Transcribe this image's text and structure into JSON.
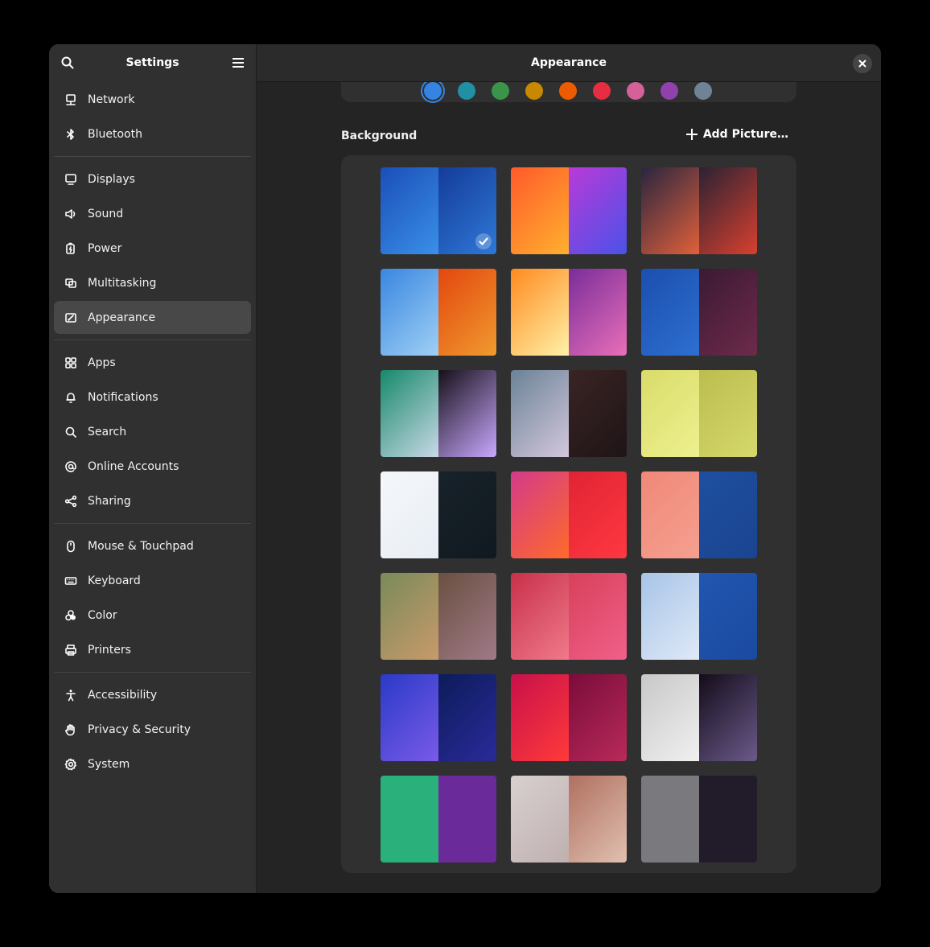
{
  "sidebar": {
    "title": "Settings",
    "search_icon": "search-icon",
    "menu_icon": "hamburger-menu-icon",
    "groups": [
      [
        {
          "label": "Network",
          "icon": "network-icon",
          "name": "network"
        },
        {
          "label": "Bluetooth",
          "icon": "bluetooth-icon",
          "name": "bluetooth"
        }
      ],
      [
        {
          "label": "Displays",
          "icon": "display-icon",
          "name": "displays"
        },
        {
          "label": "Sound",
          "icon": "speaker-icon",
          "name": "sound"
        },
        {
          "label": "Power",
          "icon": "battery-icon",
          "name": "power"
        },
        {
          "label": "Multitasking",
          "icon": "multitasking-icon",
          "name": "multitasking"
        },
        {
          "label": "Appearance",
          "icon": "appearance-icon",
          "name": "appearance",
          "active": true
        }
      ],
      [
        {
          "label": "Apps",
          "icon": "apps-grid-icon",
          "name": "apps"
        },
        {
          "label": "Notifications",
          "icon": "bell-icon",
          "name": "notifications"
        },
        {
          "label": "Search",
          "icon": "search-icon",
          "name": "search"
        },
        {
          "label": "Online Accounts",
          "icon": "at-sign-icon",
          "name": "online-accounts"
        },
        {
          "label": "Sharing",
          "icon": "share-icon",
          "name": "sharing"
        }
      ],
      [
        {
          "label": "Mouse & Touchpad",
          "icon": "mouse-icon",
          "name": "mouse-touchpad"
        },
        {
          "label": "Keyboard",
          "icon": "keyboard-icon",
          "name": "keyboard"
        },
        {
          "label": "Color",
          "icon": "color-icon",
          "name": "color"
        },
        {
          "label": "Printers",
          "icon": "printer-icon",
          "name": "printers"
        }
      ],
      [
        {
          "label": "Accessibility",
          "icon": "accessibility-icon",
          "name": "accessibility"
        },
        {
          "label": "Privacy & Security",
          "icon": "hand-icon",
          "name": "privacy-security"
        },
        {
          "label": "System",
          "icon": "gear-icon",
          "name": "system"
        }
      ]
    ]
  },
  "header": {
    "title": "Appearance",
    "close_icon": "close-icon"
  },
  "accent_colors": [
    {
      "hex": "#3584e4",
      "selected": true
    },
    {
      "hex": "#2190a4"
    },
    {
      "hex": "#3a944a"
    },
    {
      "hex": "#c88800"
    },
    {
      "hex": "#ed5b00"
    },
    {
      "hex": "#e62d42"
    },
    {
      "hex": "#d56199"
    },
    {
      "hex": "#9141ac"
    },
    {
      "hex": "#6f8396"
    }
  ],
  "background": {
    "label": "Background",
    "add_label": "Add Picture…",
    "add_icon": "plus-icon",
    "selected_icon": "checkmark-icon",
    "wallpapers": [
      {
        "left": [
          "#1a4fb8",
          "#3a8fe8"
        ],
        "right": [
          "#143c9a",
          "#2f78d6"
        ],
        "selected": true
      },
      {
        "left": [
          "#ff5a2a",
          "#ffb02e"
        ],
        "right": [
          "#b93ad8",
          "#4a52e8"
        ]
      },
      {
        "left": [
          "#2a2540",
          "#e0603a"
        ],
        "right": [
          "#2b2234",
          "#d8402e"
        ]
      },
      {
        "left": [
          "#3a86e0",
          "#9fd0f5"
        ],
        "right": [
          "#e3470f",
          "#f09a2e"
        ]
      },
      {
        "left": [
          "#ff8a1e",
          "#fff2a8"
        ],
        "right": [
          "#7a2d9a",
          "#e86fb8"
        ]
      },
      {
        "left": [
          "#1b4fae",
          "#2d6fd0"
        ],
        "right": [
          "#3a1a34",
          "#6e2a4a"
        ]
      },
      {
        "left": [
          "#16896a",
          "#c9d8e6"
        ],
        "right": [
          "#161019",
          "#c9a8ff"
        ]
      },
      {
        "left": [
          "#6b8296",
          "#d3c7dc"
        ],
        "right": [
          "#3a2424",
          "#1e1416"
        ]
      },
      {
        "left": [
          "#d9dc6a",
          "#eef08f"
        ],
        "right": [
          "#bcbd4f",
          "#d5d86c"
        ]
      },
      {
        "left": [
          "#f5f7fa",
          "#e8eef5"
        ],
        "right": [
          "#18222a",
          "#10191f"
        ]
      },
      {
        "left": [
          "#d33a8a",
          "#ff6a2a"
        ],
        "right": [
          "#e02434",
          "#ff3840"
        ]
      },
      {
        "left": [
          "#f08878",
          "#f5a090"
        ],
        "right": [
          "#1e4fa0",
          "#1a4490"
        ]
      },
      {
        "left": [
          "#7a8a5a",
          "#c89a6a"
        ],
        "right": [
          "#6a5040",
          "#a07a88"
        ]
      },
      {
        "left": [
          "#c8304a",
          "#f07a8a"
        ],
        "right": [
          "#d8405a",
          "#f0608a"
        ]
      },
      {
        "left": [
          "#a8c4e8",
          "#dfe9f7"
        ],
        "right": [
          "#2256b0",
          "#1a4aa0"
        ]
      },
      {
        "left": [
          "#2a3ac8",
          "#7a5ae8"
        ],
        "right": [
          "#0c1c5a",
          "#2a2a9a"
        ]
      },
      {
        "left": [
          "#c8104a",
          "#ff3a3a"
        ],
        "right": [
          "#7a0c3a",
          "#b82a5a"
        ]
      },
      {
        "left": [
          "#c8c8c8",
          "#f0f0f0"
        ],
        "right": [
          "#140c1a",
          "#6a5a8a"
        ]
      },
      {
        "left": [
          "#2ab07a",
          "#2ab07a"
        ],
        "right": [
          "#6a2a9a",
          "#6a2a9a"
        ]
      },
      {
        "left": [
          "#d8d0d0",
          "#c0b0b0"
        ],
        "right": [
          "#b07060",
          "#e0c0b0"
        ]
      },
      {
        "left": [
          "#7a7a7e",
          "#7a7a7e"
        ],
        "right": [
          "#221c2a",
          "#221c2a"
        ]
      }
    ]
  }
}
